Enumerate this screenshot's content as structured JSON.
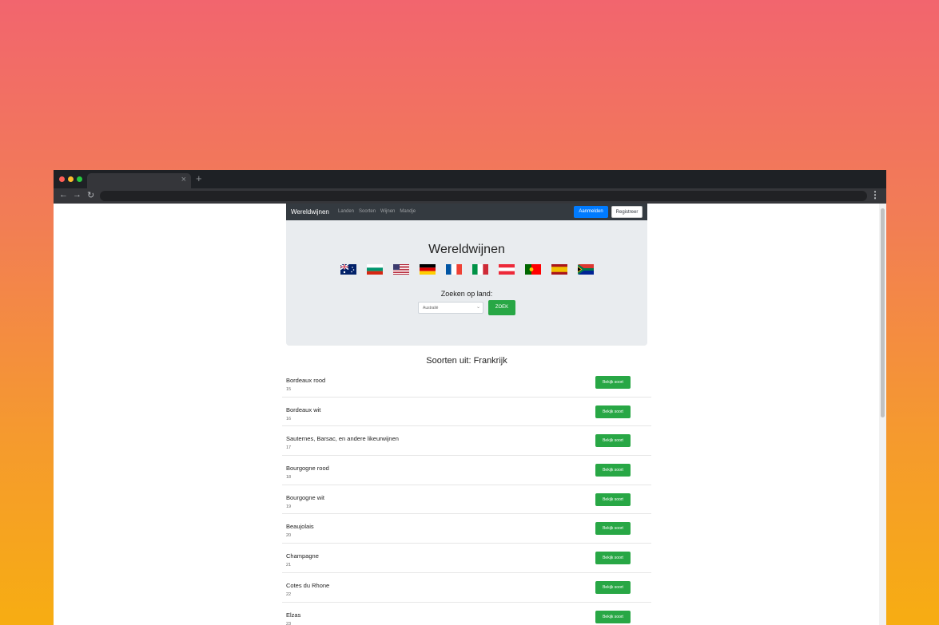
{
  "navbar": {
    "brand": "Wereldwijnen",
    "links": [
      "Landen",
      "Soorten",
      "Wijnen",
      "Mandje"
    ],
    "login": "Aanmelden",
    "register": "Registreer"
  },
  "hero": {
    "title": "Wereldwijnen",
    "flags": [
      "Australië",
      "Bulgarije",
      "Verenigde Staten",
      "Duitsland",
      "Frankrijk",
      "Italië",
      "Oostenrijk",
      "Portugal",
      "Spanje",
      "Zuid-Afrika"
    ],
    "search_label": "Zoeken op land:",
    "select_value": "Australië",
    "search_button": "ZOEK"
  },
  "list": {
    "title": "Soorten uit: Frankrijk",
    "button_label": "Bekijk soort",
    "items": [
      {
        "name": "Bordeaux rood",
        "id": "15"
      },
      {
        "name": "Bordeaux wit",
        "id": "16"
      },
      {
        "name": "Sauternes, Barsac, en andere likeurwijnen",
        "id": "17"
      },
      {
        "name": "Bourgogne rood",
        "id": "18"
      },
      {
        "name": "Bourgogne wit",
        "id": "19"
      },
      {
        "name": "Beaujolais",
        "id": "20"
      },
      {
        "name": "Champagne",
        "id": "21"
      },
      {
        "name": "Cotes du Rhone",
        "id": "22"
      },
      {
        "name": "Elzas",
        "id": "23"
      }
    ]
  }
}
